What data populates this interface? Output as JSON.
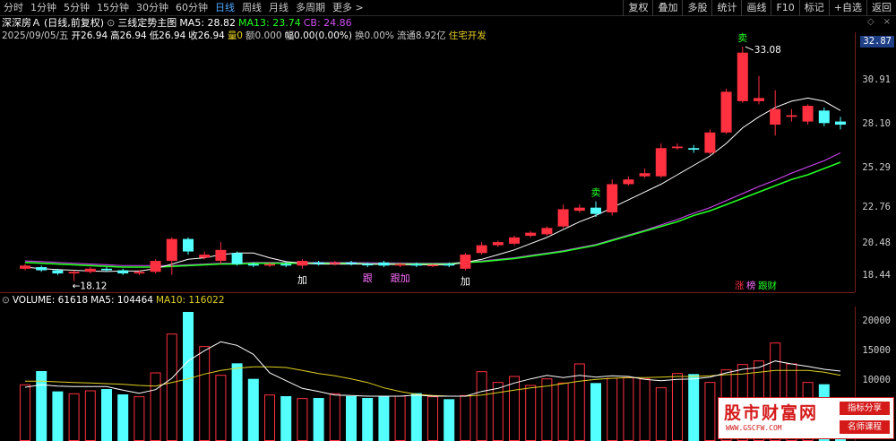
{
  "topbar": {
    "periods": [
      "分时",
      "1分钟",
      "5分钟",
      "15分钟",
      "30分钟",
      "60分钟",
      "日线",
      "周线",
      "月线",
      "多周期",
      "更多 >"
    ],
    "active_period": "日线",
    "tools": [
      "复权",
      "叠加",
      "多股",
      "统计",
      "画线",
      "F10",
      "标记",
      "+自选",
      "返回"
    ]
  },
  "title": {
    "stock": "深深房Ａ",
    "adjust": "(日线,前复权)",
    "indicator": "三线定势主图",
    "ma5": "MA5: 28.82",
    "ma13": "MA13: 23.74",
    "cb": "CB: 24.86"
  },
  "info": {
    "date": "2025/09/05/五",
    "open": "开26.94",
    "high": "高26.94",
    "low": "低26.94",
    "close": "收26.94",
    "vol": "量0",
    "amount": "额0.000",
    "change": "幅0.00(0.00%)",
    "turnover": "换0.00%",
    "float": "流通8.92亿",
    "sector": "住宅开发"
  },
  "price_axis": {
    "current": "32.87",
    "labels": [
      "30.91",
      "28.10",
      "25.29",
      "22.76",
      "20.48",
      "18.44"
    ]
  },
  "annotations": {
    "high_label": "33.08",
    "low_label": "←18.12",
    "signals": [
      "加",
      "跟",
      "跟",
      "加",
      "加",
      "卖",
      "卖"
    ],
    "tags": [
      "涨",
      "榜",
      "跟财"
    ]
  },
  "volume": {
    "label": "VOLUME: 61618",
    "ma5": "MA5: 104464",
    "ma10": "MA10: 116022",
    "axis_labels": [
      "20000",
      "15000",
      "10000"
    ]
  },
  "watermark": {
    "main": "股市财富网",
    "url": "WWW.GSCFW.COM",
    "badge1": "指标分享",
    "badge2": "名师课程"
  },
  "colors": {
    "up": "#ff3040",
    "down": "#54ffff",
    "ma5": "#ffffff",
    "ma13": "#22ff22",
    "cb": "#c040e0",
    "vol_ma5": "#ffffff",
    "vol_ma10": "#e0d020"
  },
  "chart_data": {
    "type": "candlestick",
    "candles": [
      {
        "o": 18.9,
        "c": 19.1,
        "h": 19.2,
        "l": 18.8,
        "signal": ""
      },
      {
        "o": 19.0,
        "c": 18.8,
        "h": 19.1,
        "l": 18.7,
        "signal": ""
      },
      {
        "o": 18.8,
        "c": 18.6,
        "h": 18.9,
        "l": 18.5,
        "signal": ""
      },
      {
        "o": 18.6,
        "c": 18.7,
        "h": 18.8,
        "l": 18.12,
        "signal": ""
      },
      {
        "o": 18.7,
        "c": 18.9,
        "h": 19.0,
        "l": 18.6,
        "signal": ""
      },
      {
        "o": 18.9,
        "c": 18.8,
        "h": 19.0,
        "l": 18.7,
        "signal": ""
      },
      {
        "o": 18.8,
        "c": 18.6,
        "h": 18.9,
        "l": 18.5,
        "signal": ""
      },
      {
        "o": 18.6,
        "c": 18.7,
        "h": 18.8,
        "l": 18.5,
        "signal": ""
      },
      {
        "o": 18.7,
        "c": 19.4,
        "h": 19.5,
        "l": 18.6,
        "signal": ""
      },
      {
        "o": 19.4,
        "c": 20.8,
        "h": 20.9,
        "l": 18.5,
        "signal": ""
      },
      {
        "o": 20.8,
        "c": 20.0,
        "h": 20.9,
        "l": 19.8,
        "signal": ""
      },
      {
        "o": 19.6,
        "c": 19.8,
        "h": 20.0,
        "l": 19.5,
        "signal": ""
      },
      {
        "o": 19.4,
        "c": 20.1,
        "h": 20.6,
        "l": 19.2,
        "signal": ""
      },
      {
        "o": 19.9,
        "c": 19.2,
        "h": 20.0,
        "l": 19.1,
        "signal": ""
      },
      {
        "o": 19.2,
        "c": 19.1,
        "h": 19.3,
        "l": 19.0,
        "signal": ""
      },
      {
        "o": 19.1,
        "c": 19.2,
        "h": 19.3,
        "l": 19.0,
        "signal": ""
      },
      {
        "o": 19.2,
        "c": 19.1,
        "h": 19.3,
        "l": 19.0,
        "signal": ""
      },
      {
        "o": 19.1,
        "c": 19.4,
        "h": 19.5,
        "l": 18.9,
        "signal": "加"
      },
      {
        "o": 19.3,
        "c": 19.2,
        "h": 19.4,
        "l": 19.1,
        "signal": ""
      },
      {
        "o": 19.2,
        "c": 19.3,
        "h": 19.4,
        "l": 19.1,
        "signal": ""
      },
      {
        "o": 19.3,
        "c": 19.2,
        "h": 19.4,
        "l": 19.1,
        "signal": ""
      },
      {
        "o": 19.2,
        "c": 19.15,
        "h": 19.3,
        "l": 19.0,
        "signal": "跟"
      },
      {
        "o": 19.3,
        "c": 19.1,
        "h": 19.4,
        "l": 19.0,
        "signal": ""
      },
      {
        "o": 19.1,
        "c": 19.2,
        "h": 19.3,
        "l": 19.0,
        "signal": "跟加"
      },
      {
        "o": 19.2,
        "c": 19.1,
        "h": 19.3,
        "l": 19.0,
        "signal": ""
      },
      {
        "o": 19.1,
        "c": 19.15,
        "h": 19.2,
        "l": 19.0,
        "signal": ""
      },
      {
        "o": 19.2,
        "c": 19.1,
        "h": 19.3,
        "l": 19.0,
        "signal": ""
      },
      {
        "o": 18.9,
        "c": 19.8,
        "h": 19.9,
        "l": 18.8,
        "signal": "加"
      },
      {
        "o": 19.9,
        "c": 20.4,
        "h": 20.6,
        "l": 19.8,
        "signal": ""
      },
      {
        "o": 20.4,
        "c": 20.6,
        "h": 20.7,
        "l": 20.3,
        "signal": ""
      },
      {
        "o": 20.5,
        "c": 20.9,
        "h": 21.0,
        "l": 20.4,
        "signal": ""
      },
      {
        "o": 21.0,
        "c": 21.2,
        "h": 21.3,
        "l": 20.9,
        "signal": ""
      },
      {
        "o": 21.1,
        "c": 21.5,
        "h": 21.6,
        "l": 21.0,
        "signal": ""
      },
      {
        "o": 21.6,
        "c": 22.7,
        "h": 23.0,
        "l": 21.5,
        "signal": ""
      },
      {
        "o": 22.6,
        "c": 22.8,
        "h": 23.0,
        "l": 22.5,
        "signal": ""
      },
      {
        "o": 22.8,
        "c": 22.4,
        "h": 23.2,
        "l": 22.2,
        "signal": "卖"
      },
      {
        "o": 22.5,
        "c": 24.3,
        "h": 24.6,
        "l": 22.3,
        "signal": ""
      },
      {
        "o": 24.3,
        "c": 24.6,
        "h": 24.8,
        "l": 24.2,
        "signal": ""
      },
      {
        "o": 24.8,
        "c": 25.0,
        "h": 25.3,
        "l": 24.7,
        "signal": ""
      },
      {
        "o": 24.8,
        "c": 26.6,
        "h": 26.9,
        "l": 24.7,
        "signal": ""
      },
      {
        "o": 26.6,
        "c": 26.7,
        "h": 26.9,
        "l": 26.5,
        "signal": ""
      },
      {
        "o": 26.6,
        "c": 26.5,
        "h": 26.8,
        "l": 26.3,
        "signal": ""
      },
      {
        "o": 26.3,
        "c": 27.6,
        "h": 27.8,
        "l": 26.2,
        "signal": ""
      },
      {
        "o": 27.6,
        "c": 30.2,
        "h": 30.4,
        "l": 27.5,
        "signal": ""
      },
      {
        "o": 29.6,
        "c": 32.7,
        "h": 33.08,
        "l": 29.5,
        "signal": "卖"
      },
      {
        "o": 29.6,
        "c": 29.8,
        "h": 31.2,
        "l": 29.4,
        "signal": ""
      },
      {
        "o": 28.1,
        "c": 29.1,
        "h": 30.3,
        "l": 27.4,
        "signal": ""
      },
      {
        "o": 28.6,
        "c": 28.7,
        "h": 29.1,
        "l": 28.3,
        "signal": ""
      },
      {
        "o": 28.3,
        "c": 29.3,
        "h": 29.4,
        "l": 28.1,
        "signal": ""
      },
      {
        "o": 29.0,
        "c": 28.2,
        "h": 29.2,
        "l": 28.0,
        "signal": ""
      },
      {
        "o": 28.3,
        "c": 28.1,
        "h": 28.6,
        "l": 27.8,
        "signal": ""
      }
    ],
    "ma5": [
      19.0,
      18.9,
      18.85,
      18.8,
      18.75,
      18.72,
      18.75,
      18.75,
      18.9,
      19.2,
      19.5,
      19.6,
      19.8,
      19.9,
      19.9,
      19.6,
      19.35,
      19.25,
      19.2,
      19.2,
      19.2,
      19.2,
      19.18,
      19.16,
      19.15,
      19.15,
      19.15,
      19.3,
      19.5,
      19.8,
      20.1,
      20.5,
      20.9,
      21.4,
      21.9,
      22.3,
      22.8,
      23.3,
      23.8,
      24.3,
      24.9,
      25.5,
      26.1,
      26.9,
      27.9,
      28.6,
      29.2,
      29.6,
      29.8,
      29.6,
      29.0
    ],
    "ma13": [
      19.3,
      19.25,
      19.2,
      19.15,
      19.1,
      19.05,
      19.0,
      19.0,
      19.0,
      19.05,
      19.1,
      19.15,
      19.2,
      19.2,
      19.25,
      19.25,
      19.25,
      19.25,
      19.25,
      19.25,
      19.25,
      19.2,
      19.2,
      19.2,
      19.2,
      19.2,
      19.2,
      19.3,
      19.35,
      19.45,
      19.55,
      19.7,
      19.85,
      20.0,
      20.2,
      20.4,
      20.7,
      21.0,
      21.3,
      21.6,
      21.9,
      22.3,
      22.6,
      23.0,
      23.4,
      23.8,
      24.2,
      24.6,
      24.9,
      25.3,
      25.7
    ],
    "cb": [
      19.4,
      19.35,
      19.3,
      19.25,
      19.2,
      19.15,
      19.1,
      19.1,
      19.1,
      19.1,
      19.15,
      19.2,
      19.25,
      19.25,
      19.3,
      19.3,
      19.3,
      19.3,
      19.3,
      19.3,
      19.3,
      19.28,
      19.27,
      19.26,
      19.25,
      19.25,
      19.25,
      19.32,
      19.4,
      19.5,
      19.6,
      19.75,
      19.9,
      20.05,
      20.25,
      20.45,
      20.75,
      21.05,
      21.35,
      21.7,
      22.05,
      22.45,
      22.8,
      23.25,
      23.7,
      24.15,
      24.55,
      25.0,
      25.4,
      25.8,
      26.3
    ],
    "volume": {
      "values": [
        9400,
        11700,
        8300,
        7900,
        8400,
        8700,
        7800,
        7400,
        11400,
        17900,
        21600,
        15800,
        11000,
        13000,
        10400,
        7700,
        7500,
        7100,
        7200,
        7900,
        7500,
        7200,
        7500,
        7500,
        8000,
        7400,
        7000,
        7600,
        11600,
        9800,
        10800,
        9300,
        10400,
        9700,
        12900,
        9700,
        10500,
        10600,
        10400,
        8900,
        11300,
        11200,
        9800,
        11900,
        12800,
        13400,
        16400,
        12900,
        9800,
        9500,
        6500
      ],
      "ma5": [
        9000,
        9400,
        9200,
        9100,
        9100,
        9100,
        8500,
        8000,
        8600,
        10500,
        13400,
        15100,
        16600,
        16000,
        14500,
        11400,
        10100,
        8800,
        8300,
        7700,
        7600,
        7500,
        7500,
        7500,
        7700,
        7500,
        7500,
        7500,
        8300,
        8800,
        9700,
        10400,
        11000,
        10600,
        11000,
        10700,
        10900,
        10800,
        10300,
        10100,
        10300,
        10400,
        10700,
        11400,
        12000,
        12300,
        13400,
        12900,
        12500,
        12000,
        11700
      ],
      "ma10": [
        10000,
        10000,
        9900,
        9800,
        9700,
        9600,
        9500,
        9300,
        9200,
        9800,
        10400,
        11200,
        11800,
        12200,
        12400,
        12400,
        12300,
        11800,
        11300,
        10900,
        10400,
        9800,
        8900,
        8300,
        7800,
        7600,
        7500,
        7500,
        7700,
        8100,
        8500,
        8900,
        9200,
        9600,
        10000,
        10300,
        10500,
        10600,
        10600,
        10700,
        10800,
        10800,
        10900,
        11100,
        11200,
        11500,
        11800,
        11800,
        11800,
        11500,
        11000
      ]
    },
    "ylim_price": [
      17.4,
      34.0
    ],
    "ylim_volume": [
      0,
      22500
    ]
  }
}
